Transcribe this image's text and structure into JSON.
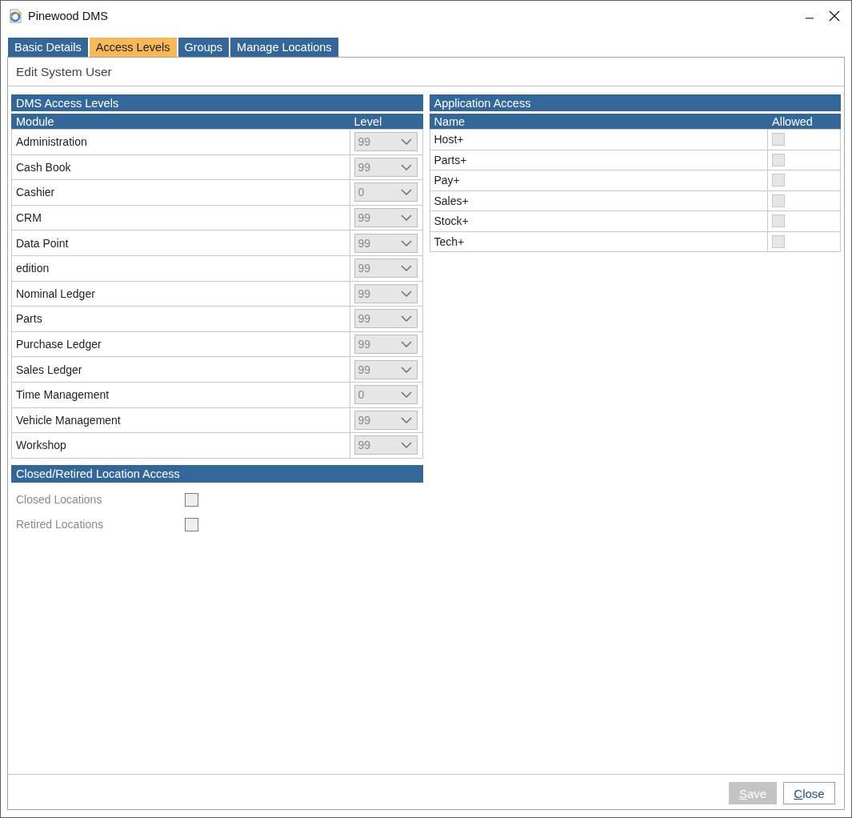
{
  "window": {
    "title": "Pinewood DMS"
  },
  "tabs": [
    {
      "label": "Basic Details",
      "selected": false
    },
    {
      "label": "Access Levels",
      "selected": true
    },
    {
      "label": "Groups",
      "selected": false
    },
    {
      "label": "Manage Locations",
      "selected": false
    }
  ],
  "panel": {
    "title": "Edit System User"
  },
  "dms_access_levels": {
    "title": "DMS Access Levels",
    "columns": [
      "Module",
      "Level"
    ],
    "rows": [
      {
        "module": "Administration",
        "value": "99",
        "disabled": true
      },
      {
        "module": "Cash Book",
        "value": "99",
        "disabled": true
      },
      {
        "module": "Cashier",
        "value": "0",
        "disabled": true
      },
      {
        "module": "CRM",
        "value": "99",
        "disabled": true
      },
      {
        "module": "Data Point",
        "value": "99",
        "disabled": true
      },
      {
        "module": "edition",
        "value": "99",
        "disabled": true
      },
      {
        "module": "Nominal Ledger",
        "value": "99",
        "disabled": true
      },
      {
        "module": "Parts",
        "value": "99",
        "disabled": true
      },
      {
        "module": "Purchase Ledger",
        "value": "99",
        "disabled": true
      },
      {
        "module": "Sales Ledger",
        "value": "99",
        "disabled": true
      },
      {
        "module": "Time Management",
        "value": "0",
        "disabled": true
      },
      {
        "module": "Vehicle Management",
        "value": "99",
        "disabled": true
      },
      {
        "module": "Workshop",
        "value": "99",
        "disabled": true
      }
    ]
  },
  "location_access": {
    "title": "Closed/Retired Location Access",
    "options": [
      {
        "label": "Closed Locations",
        "checked": false,
        "disabled": true
      },
      {
        "label": "Retired Locations",
        "checked": false,
        "disabled": true
      }
    ]
  },
  "application_access": {
    "title": "Application Access",
    "columns": [
      "Name",
      "Allowed"
    ],
    "rows": [
      {
        "name": "Host+",
        "allowed": false,
        "disabled": true
      },
      {
        "name": "Parts+",
        "allowed": false,
        "disabled": true
      },
      {
        "name": "Pay+",
        "allowed": false,
        "disabled": true
      },
      {
        "name": "Sales+",
        "allowed": false,
        "disabled": true
      },
      {
        "name": "Stock+",
        "allowed": false,
        "disabled": true
      },
      {
        "name": "Tech+",
        "allowed": false,
        "disabled": true
      }
    ]
  },
  "buttons": [
    {
      "label": "Save",
      "disabled": true,
      "focused": false,
      "mnemonic_underlined": true
    },
    {
      "label": "Close",
      "disabled": false,
      "focused": true,
      "mnemonic_underlined": true
    }
  ]
}
